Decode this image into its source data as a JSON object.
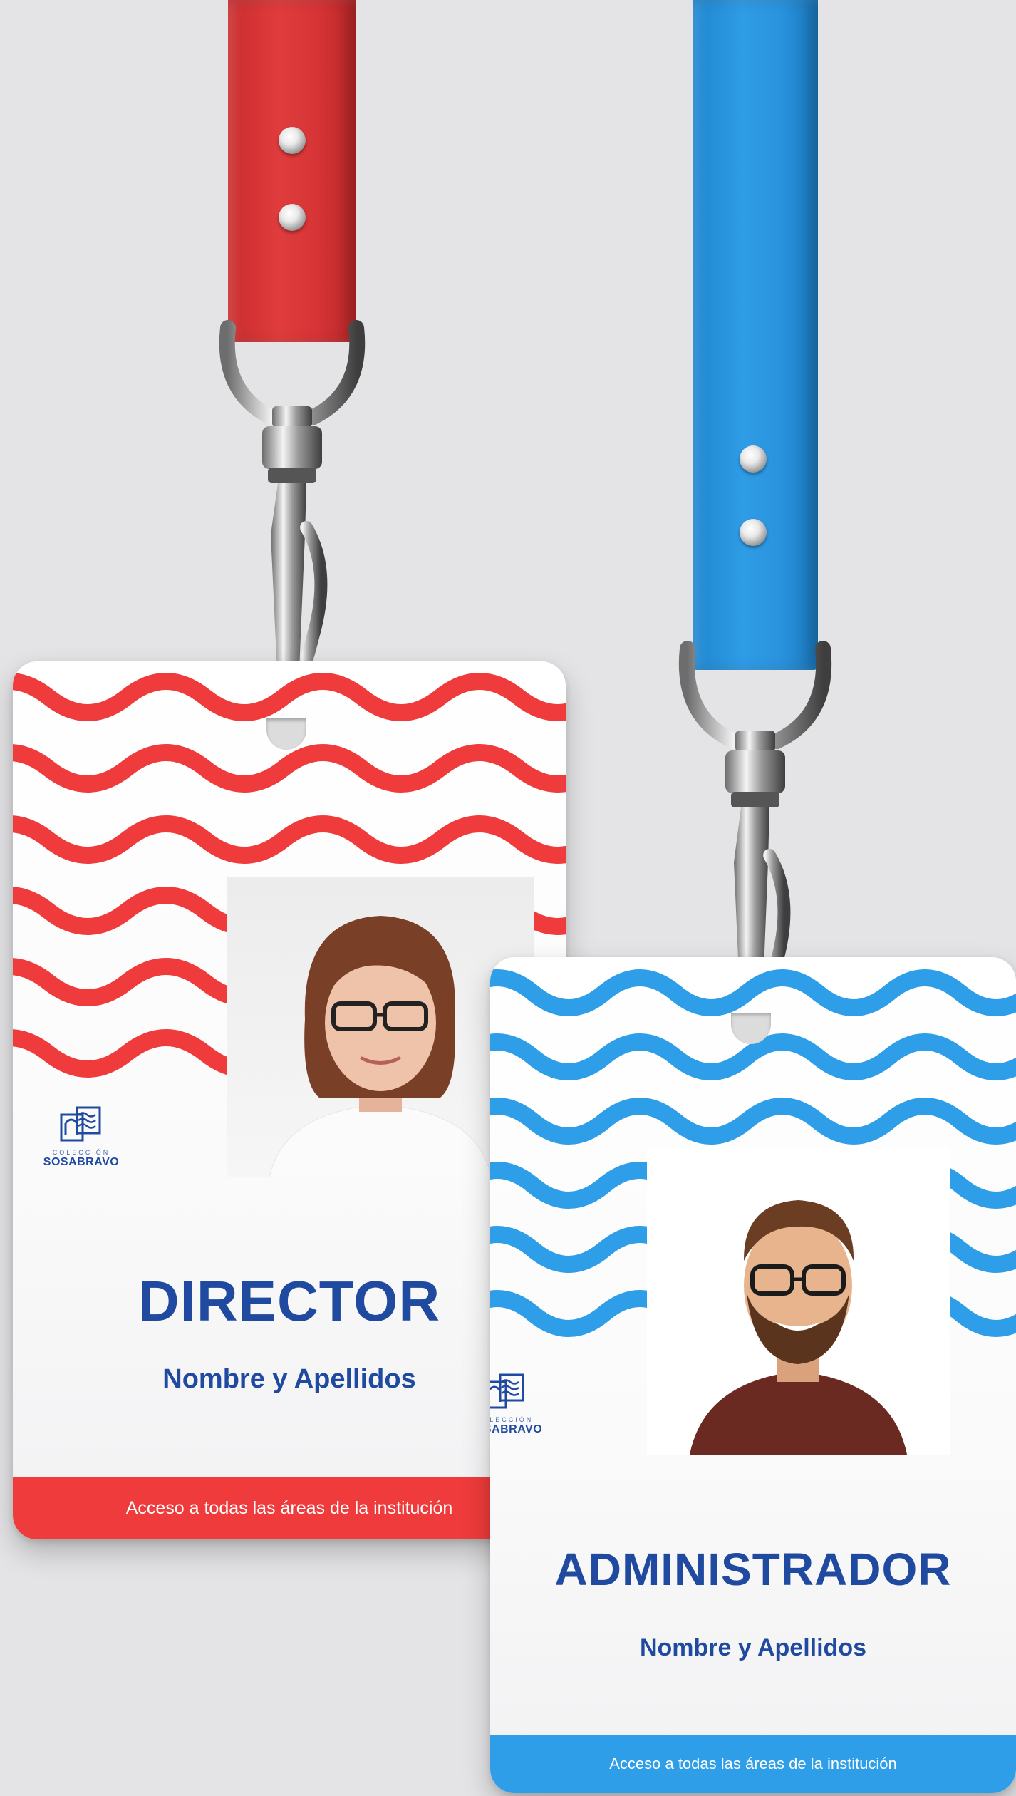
{
  "colors": {
    "background": "#e4e4e6",
    "red_accent": "#ef3b3b",
    "blue_accent": "#2e9ee8",
    "text_navy": "#1f4aa0"
  },
  "badges": [
    {
      "role": "DIRECTOR",
      "name": "Nombre y Apellidos",
      "footer": "Acceso a todas las áreas de la institución",
      "lanyard_color": "red",
      "logo": {
        "sub": "COLECCIÓN",
        "main": "SOSABRAVO"
      }
    },
    {
      "role": "ADMINISTRADOR",
      "name": "Nombre y Apellidos",
      "footer": "Acceso a todas las áreas de la institución",
      "lanyard_color": "blue",
      "logo": {
        "sub": "COLECCIÓN",
        "main": "SOSABRAVO"
      }
    }
  ]
}
